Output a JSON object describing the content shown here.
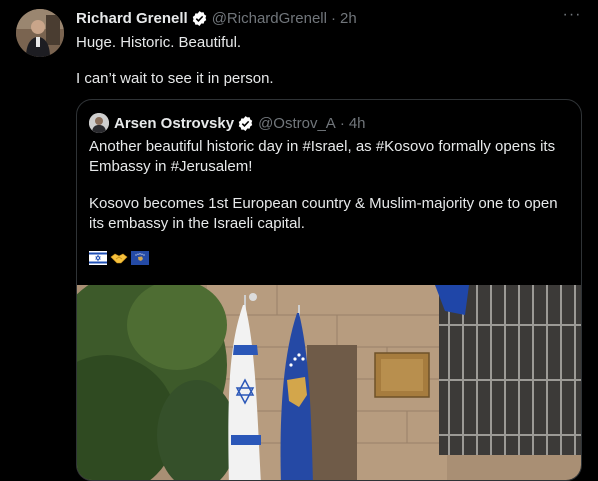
{
  "author": {
    "name": "Richard Grenell",
    "handle": "@RichardGrenell",
    "separator": "·",
    "time": "2h"
  },
  "tweet": {
    "line1": "Huge. Historic. Beautiful.",
    "line2": "I can’t wait to see it in person."
  },
  "more_icon": "···",
  "quote": {
    "name": "Arsen Ostrovsky",
    "handle": "@Ostrov_A",
    "separator": "·",
    "time": "4h",
    "p1_line1": "Another beautiful historic day in #Israel, as #Kosovo formally opens its",
    "p1_line2": "Embassy in #Jerusalem!",
    "p2_line1": "Kosovo becomes 1st European country & Muslim-majority one to open",
    "p2_line2": "its embassy in the Israeli capital.",
    "emojis": [
      "israel-flag-icon",
      "handshake-icon",
      "kosovo-flag-icon"
    ]
  },
  "colors": {
    "background": "#000000",
    "text": "#e7e9ea",
    "muted": "#71767b",
    "border": "#2f3336",
    "verified": "#ffffff"
  }
}
